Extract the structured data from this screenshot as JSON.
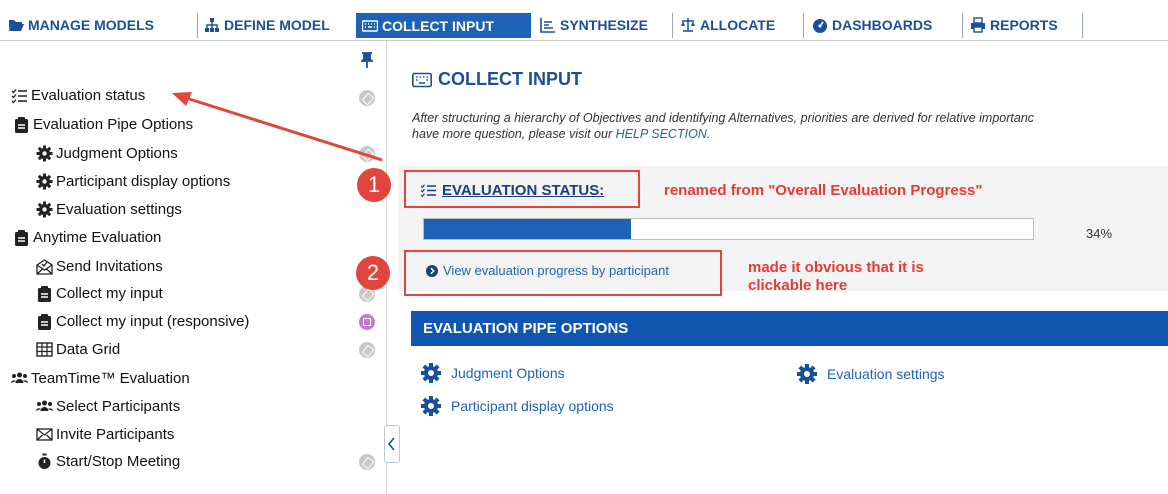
{
  "nav": {
    "tabs": [
      {
        "label": "MANAGE MODELS",
        "icon": "folder-open-icon"
      },
      {
        "label": "DEFINE MODEL",
        "icon": "sitemap-icon"
      },
      {
        "label": "COLLECT INPUT",
        "icon": "keyboard-icon",
        "active": true
      },
      {
        "label": "SYNTHESIZE",
        "icon": "align-left-icon"
      },
      {
        "label": "ALLOCATE",
        "icon": "balance-scale-icon"
      },
      {
        "label": "DASHBOARDS",
        "icon": "tachometer-icon"
      },
      {
        "label": "REPORTS",
        "icon": "print-icon"
      }
    ]
  },
  "sidebar": {
    "items": [
      {
        "label": "Evaluation status",
        "icon": "tasks-icon",
        "status": "gray"
      },
      {
        "label": "Evaluation Pipe Options",
        "icon": "clipboard-icon"
      },
      {
        "label": "Judgment Options",
        "icon": "cog-icon",
        "status": "gray"
      },
      {
        "label": "Participant display options",
        "icon": "cog-icon"
      },
      {
        "label": "Evaluation settings",
        "icon": "cog-icon"
      },
      {
        "label": "Anytime Evaluation",
        "icon": "clipboard-icon"
      },
      {
        "label": "Send Invitations",
        "icon": "envelope-open-icon"
      },
      {
        "label": "Collect my input",
        "icon": "clipboard-icon",
        "status": "gray"
      },
      {
        "label": "Collect my input (responsive)",
        "icon": "clipboard-icon",
        "status": "purple"
      },
      {
        "label": "Data Grid",
        "icon": "table-icon",
        "status": "gray"
      },
      {
        "label": "TeamTime™ Evaluation",
        "icon": "users-icon"
      },
      {
        "label": "Select Participants",
        "icon": "users-icon"
      },
      {
        "label": "Invite Participants",
        "icon": "envelope-icon"
      },
      {
        "label": "Start/Stop Meeting",
        "icon": "stopwatch-icon",
        "status": "gray"
      }
    ]
  },
  "main": {
    "title": "COLLECT INPUT",
    "intro_line1": "After structuring a hierarchy of Objectives and identifying Alternatives, priorities are derived for relative importanc",
    "intro_line2_prefix": "have more question, please visit our ",
    "intro_link": "HELP SECTION",
    "intro_line2_suffix": ".",
    "eval_status_title": "EVALUATION STATUS:",
    "progress_percent": 34,
    "progress_label": "34%",
    "view_progress_link": "View evaluation progress by participant",
    "pipe_options_header": "EVALUATION PIPE OPTIONS",
    "pipe_options": [
      {
        "label": "Judgment Options",
        "icon": "cog-icon"
      },
      {
        "label": "Evaluation settings",
        "icon": "cog-icon"
      },
      {
        "label": "Participant display options",
        "icon": "cog-icon"
      }
    ]
  },
  "annotations": {
    "one": "1",
    "two": "2",
    "note1": "renamed from \"Overall Evaluation Progress\"",
    "note2_line1": "made it obvious that it is",
    "note2_line2": "clickable here",
    "color": "#e0463f"
  },
  "colors": {
    "accent": "#1e62b8",
    "section_header": "#0e56b0",
    "annotation": "#e0463f"
  }
}
